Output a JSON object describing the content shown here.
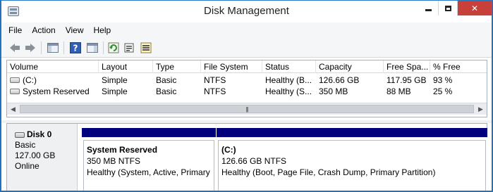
{
  "window": {
    "title": "Disk Management",
    "controls": {
      "minimize": "minimize",
      "maximize": "maximize",
      "close": "✕"
    }
  },
  "menu": [
    "File",
    "Action",
    "View",
    "Help"
  ],
  "toolbar": {
    "icons": [
      "back-icon",
      "forward-icon",
      "show-hide-console-tree-icon",
      "help-icon",
      "show-hide-action-pane-icon",
      "refresh-icon",
      "properties-icon",
      "rescan-disks-icon"
    ]
  },
  "volumes": {
    "columns": [
      "Volume",
      "Layout",
      "Type",
      "File System",
      "Status",
      "Capacity",
      "Free Spa...",
      "% Free"
    ],
    "rows": [
      [
        "(C:)",
        "Simple",
        "Basic",
        "NTFS",
        "Healthy (B...",
        "126.66 GB",
        "117.95 GB",
        "93 %"
      ],
      [
        "System Reserved",
        "Simple",
        "Basic",
        "NTFS",
        "Healthy (S...",
        "350 MB",
        "88 MB",
        "25 %"
      ]
    ],
    "scroll_grip": "|||"
  },
  "disk": {
    "name": "Disk 0",
    "type": "Basic",
    "size": "127.00 GB",
    "status": "Online",
    "bar_color": "#00007f",
    "partitions": [
      {
        "name": "System Reserved",
        "size_fs": "350 MB NTFS",
        "status": "Healthy (System, Active, Primary"
      },
      {
        "name": "(C:)",
        "size_fs": "126.66 GB NTFS",
        "status": "Healthy (Boot, Page File, Crash Dump, Primary Partition)"
      }
    ]
  }
}
